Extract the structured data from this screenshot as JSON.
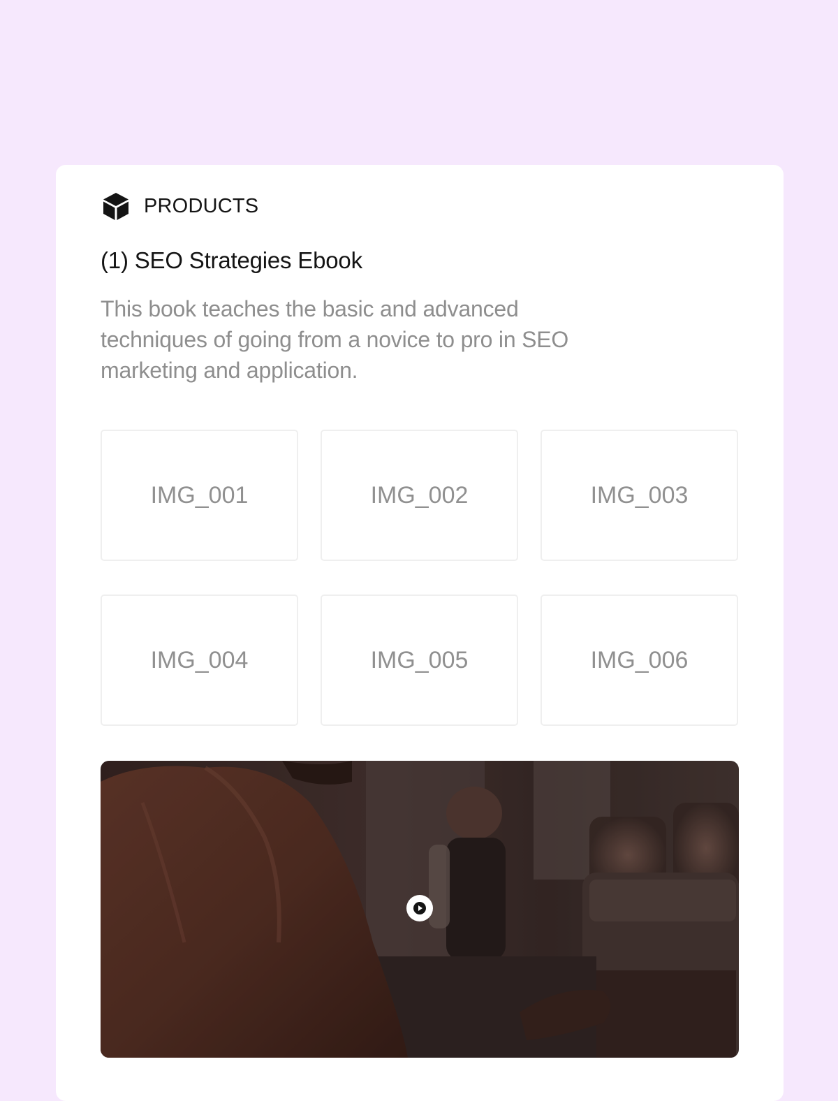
{
  "section": {
    "title": "PRODUCTS",
    "icon": "box-icon"
  },
  "product": {
    "title": "(1) SEO Strategies Ebook",
    "description": "This book teaches the basic and advanced techniques of going from a novice to pro in SEO marketing and application."
  },
  "images": [
    {
      "label": "IMG_001"
    },
    {
      "label": "IMG_002"
    },
    {
      "label": "IMG_003"
    },
    {
      "label": "IMG_004"
    },
    {
      "label": "IMG_005"
    },
    {
      "label": "IMG_006"
    }
  ],
  "video": {
    "play_icon": "play-icon"
  },
  "colors": {
    "page_background": "#F6E8FD",
    "card_background": "#FFFFFF",
    "title_text": "#141414",
    "muted_text": "#8E8E8E"
  }
}
